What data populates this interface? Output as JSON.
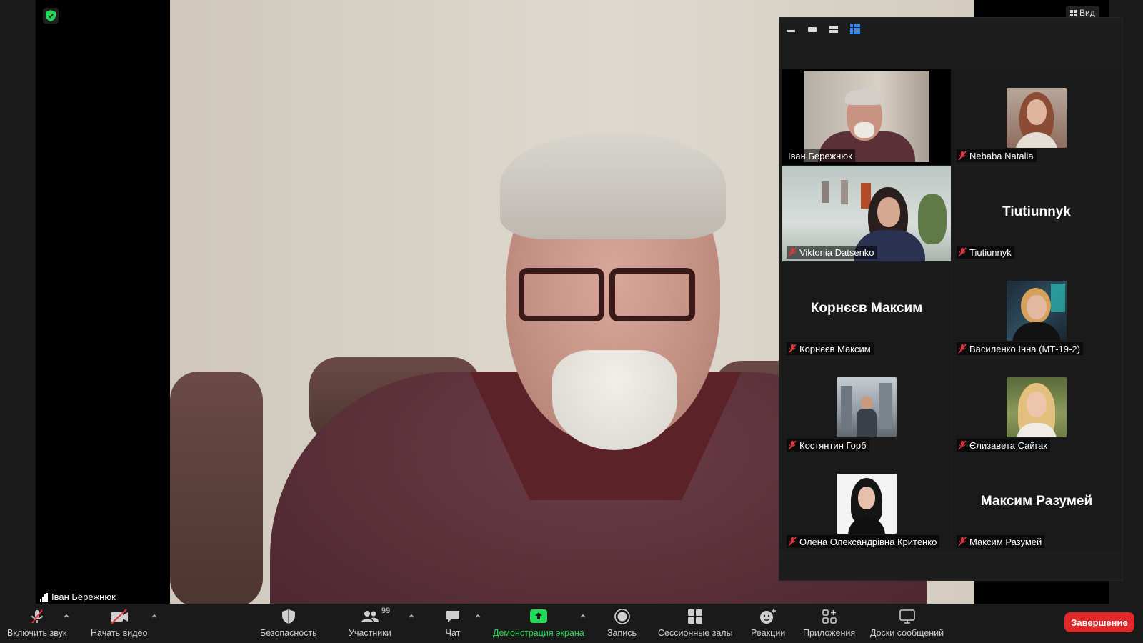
{
  "view_button": {
    "label": "Вид",
    "icon": "grid-icon"
  },
  "main_speaker": {
    "name": "Іван Бережнюк"
  },
  "gallery": {
    "tiles": [
      {
        "name": "Іван Бережнюк",
        "type": "video",
        "active": true,
        "muted": false
      },
      {
        "name": "Nebaba Natalia",
        "type": "photo",
        "muted": true
      },
      {
        "name": "Viktoriia Datsenko",
        "type": "video",
        "muted": true
      },
      {
        "name": "Tiutiunnyk",
        "type": "text",
        "display": "Tiutiunnyk",
        "muted": true
      },
      {
        "name": "Корнєєв Максим",
        "type": "text",
        "display": "Корнєєв Максим",
        "muted": true
      },
      {
        "name": "Василенко Інна (МТ-19-2)",
        "type": "photo",
        "muted": true
      },
      {
        "name": "Костянтин Горб",
        "type": "photo",
        "muted": true
      },
      {
        "name": "Єлизавета Сайгак",
        "type": "photo",
        "muted": true
      },
      {
        "name": "Олена Олександрівна Критенко",
        "type": "photo",
        "muted": true
      },
      {
        "name": "Максим Разумей",
        "type": "text",
        "display": "Максим Разумей",
        "muted": true
      }
    ]
  },
  "toolbar": {
    "unmute": "Включить звук",
    "start_video": "Начать видео",
    "security": "Безопасность",
    "participants": "Участники",
    "participants_count": "99",
    "chat": "Чат",
    "share_screen": "Демонстрация экрана",
    "record": "Запись",
    "breakout": "Сессионные залы",
    "reactions": "Реакции",
    "apps": "Приложения",
    "whiteboards": "Доски сообщений",
    "end": "Завершение"
  },
  "colors": {
    "accent_green": "#23d959",
    "end_red": "#e02828",
    "active_border": "#e2e35a",
    "muted_red": "#e8343f",
    "grid_blue": "#2d8cff"
  }
}
